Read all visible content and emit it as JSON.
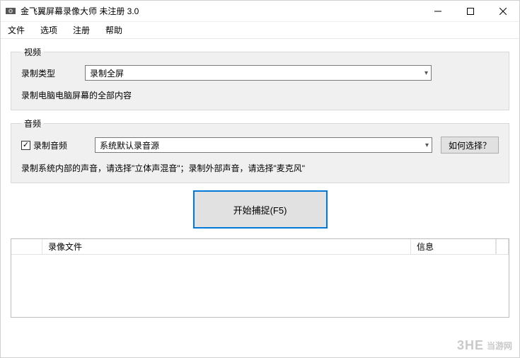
{
  "window": {
    "title": "金飞翼屏幕录像大师 未注册 3.0"
  },
  "menu": {
    "file": "文件",
    "options": "选项",
    "register": "注册",
    "help": "帮助"
  },
  "video": {
    "legend": "视频",
    "type_label": "录制类型",
    "type_value": "录制全屏",
    "desc": "录制电脑电脑屏幕的全部内容"
  },
  "audio": {
    "legend": "音频",
    "record_label": "录制音频",
    "record_checked": true,
    "source_value": "系统默认录音源",
    "howto_btn": "如何选择？",
    "desc": "录制系统内部的声音，请选择\"立体声混音\"；录制外部声音，请选择\"麦克风\""
  },
  "capture": {
    "label": "开始捕捉(F5)"
  },
  "list": {
    "col_file": "录像文件",
    "col_info": "信息"
  },
  "watermark": {
    "brand": "3HE",
    "site": "当游网"
  }
}
